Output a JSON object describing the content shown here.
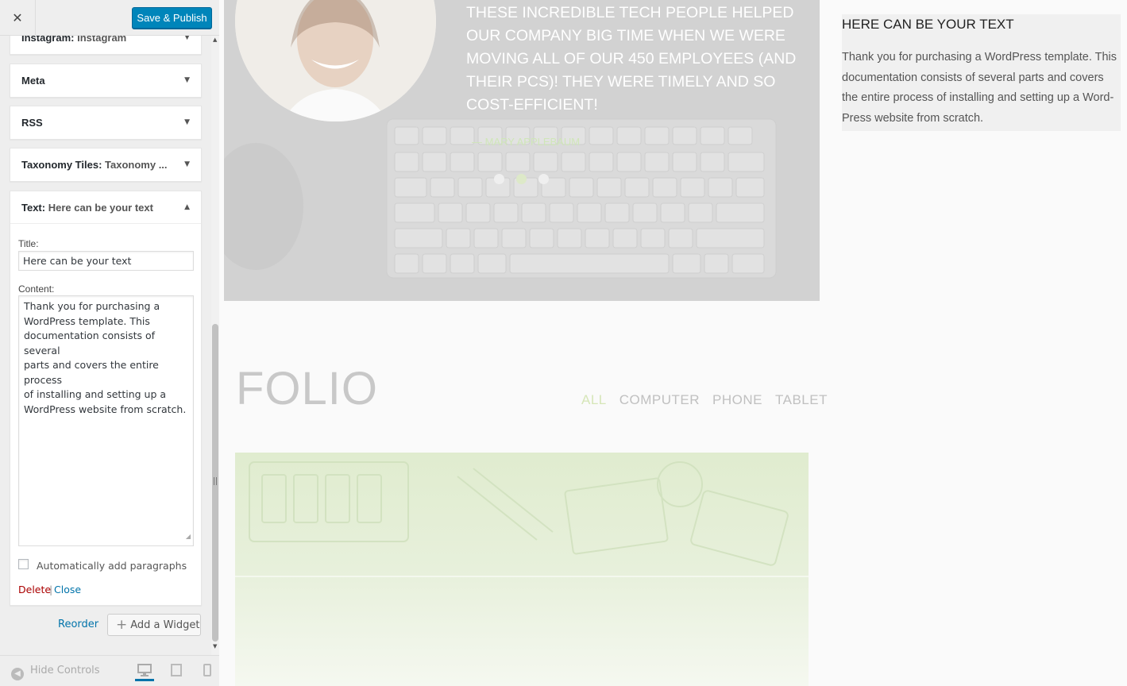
{
  "header": {
    "close_icon": "✕",
    "save_label": "Save & Publish"
  },
  "widgets": [
    {
      "type": "Instagram",
      "title": "Instagram",
      "arrow": "▼"
    },
    {
      "type": "Meta",
      "title": "",
      "arrow": "▼"
    },
    {
      "type": "RSS",
      "title": "",
      "arrow": "▼"
    },
    {
      "type": "Taxonomy Tiles",
      "title": "Taxonomy ...",
      "arrow": "▼"
    },
    {
      "type": "Text",
      "title": "Here can be your text",
      "arrow": "▲"
    }
  ],
  "text_widget": {
    "title_label": "Title:",
    "title_value": "Here can be your text",
    "content_label": "Content:",
    "content_value": "Thank you for purchasing a\nWordPress template. This\ndocumentation consists of several\nparts and covers the entire process\nof installing and setting up a\nWordPress website from scratch.",
    "auto_paragraphs_label": "Automatically add paragraphs",
    "auto_paragraphs_checked": false,
    "delete_label": "Delete",
    "separator": "|",
    "close_label": "Close"
  },
  "actions": {
    "reorder_label": "Reorder",
    "add_widget_label": "Add a Widget",
    "plus_icon": "+"
  },
  "footer": {
    "hide_controls_label": "Hide Controls",
    "devices": [
      "desktop",
      "tablet",
      "mobile"
    ],
    "active_device": "desktop"
  },
  "preview": {
    "testimonial_quote": "These incredible tech people helped our company big time when we were moving all of our 450 employees (and their PCs)! They were timely and so cost-efficient!",
    "testimonial_author": "— Mary Applebaum",
    "slider_dots": 3,
    "active_dot": 2,
    "folio_title": "FOLIO",
    "filters": [
      "ALL",
      "COMPUTER",
      "PHONE",
      "TABLET"
    ],
    "active_filter": "ALL",
    "sidebar_title": "Here can be your text",
    "sidebar_text": "Thank you for purchasing a WordPress template. This documentation consists of several parts and covers the entire process of installing and setting up a Word-Press website from scratch."
  },
  "colors": {
    "primary_button": "#0085ba",
    "delete_link": "#aa0000",
    "link": "#0073aa",
    "accent_green": "#d6e6b8"
  }
}
